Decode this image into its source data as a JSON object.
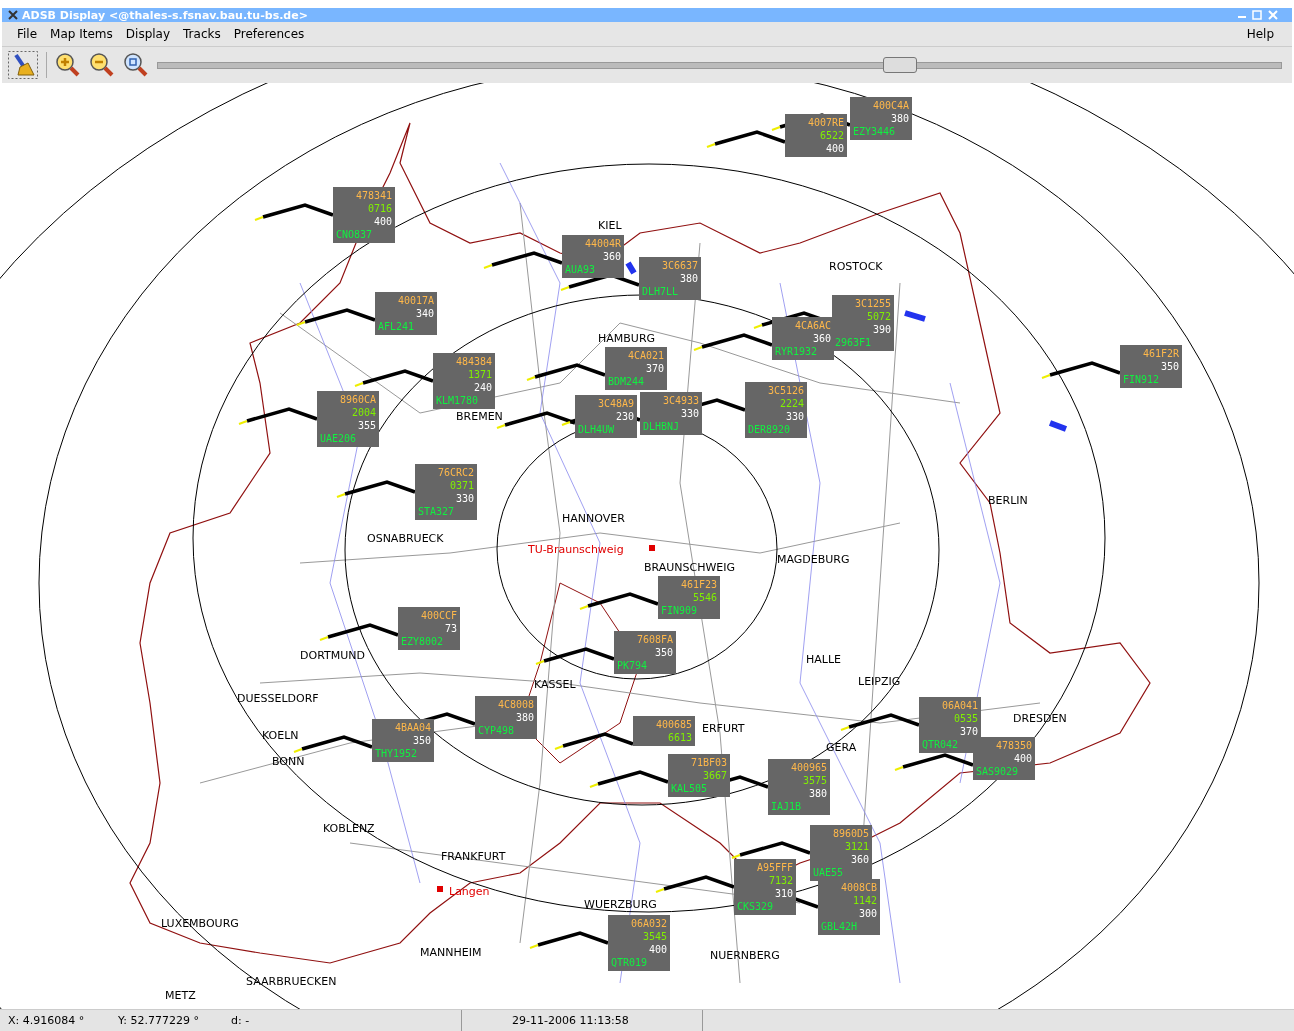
{
  "window": {
    "title": "ADSB Display <@thales-s.fsnav.bau.tu-bs.de>"
  },
  "menu": [
    {
      "label": "File"
    },
    {
      "label": "Map Items"
    },
    {
      "label": "Display"
    },
    {
      "label": "Tracks"
    },
    {
      "label": "Preferences"
    },
    {
      "label": "Help"
    }
  ],
  "zoom_slider": {
    "level": 0.66
  },
  "map": {
    "cities": [
      "KIEL",
      "ROSTOCK",
      "HAMBURG",
      "BREMEN",
      "HANNOVER",
      "OSNABRUECK",
      "BRAUNSCHWEIG",
      "MAGDEBURG",
      "BERLIN",
      "DORTMUND",
      "DUESSELDORF",
      "KOELN",
      "BONN",
      "KASSEL",
      "HALLE",
      "LEIPZIG",
      "ERFURT",
      "GERA",
      "DRESDEN",
      "KOBLENZ",
      "FRANKFURT",
      "WUERZBURG",
      "MANNHEIM",
      "NUERNBERG",
      "LUXEMBOURG",
      "SAARBRUECKEN",
      "METZ"
    ],
    "sites": [
      "TU-Braunschweig",
      "Langen"
    ],
    "aircraft": [
      {
        "icao": "4007RE",
        "squawk": "6522",
        "altitude": "400"
      },
      {
        "icao": "400C4A",
        "altitude": "380",
        "callsign": "EZY3446"
      },
      {
        "icao": "478341",
        "squawk": "0716",
        "altitude": "400",
        "callsign": "CNO837"
      },
      {
        "icao": "44004R",
        "altitude": "360",
        "callsign": "AUA93"
      },
      {
        "icao": "3C6637",
        "altitude": "380",
        "callsign": "DLH7LL"
      },
      {
        "icao": "40017A",
        "altitude": "340",
        "callsign": "AFL241"
      },
      {
        "icao": "4CA6AC",
        "altitude": "360",
        "callsign": "RYR1932"
      },
      {
        "icao": "3C1255",
        "squawk": "5072",
        "altitude": "390",
        "callsign": "2963F1"
      },
      {
        "icao": "4CA021",
        "altitude": "370",
        "callsign": "BDM244"
      },
      {
        "icao": "8960CA",
        "squawk": "2004",
        "altitude": "355",
        "callsign": "UAE206"
      },
      {
        "icao": "484384",
        "squawk": "1371",
        "altitude": "240",
        "callsign": "KLM1780"
      },
      {
        "icao": "3C48A9",
        "altitude": "230",
        "callsign": "DLH4UW"
      },
      {
        "icao": "3C4933",
        "altitude": "330",
        "callsign": "DLHBNJ"
      },
      {
        "icao": "3C5126",
        "squawk": "2224",
        "altitude": "330",
        "callsign": "DER8920"
      },
      {
        "icao": "461F2R",
        "altitude": "350",
        "callsign": "FIN912"
      },
      {
        "icao": "76CRC2",
        "squawk": "0371",
        "altitude": "330",
        "callsign": "STA327"
      },
      {
        "icao": "461F23",
        "squawk": "5546",
        "callsign": "FIN909"
      },
      {
        "icao": "400CCF",
        "altitude": "73",
        "callsign": "EZY8002"
      },
      {
        "icao": "7608FA",
        "altitude": "350",
        "callsign": "PK794"
      },
      {
        "icao": "4BAA04",
        "altitude": "350",
        "callsign": "THY1952"
      },
      {
        "icao": "4C8008",
        "altitude": "380",
        "callsign": "CYP498"
      },
      {
        "icao": "400685",
        "squawk": "6613"
      },
      {
        "icao": "06A041",
        "squawk": "0535",
        "altitude": "370",
        "callsign": "QTR042"
      },
      {
        "icao": "71BF03",
        "squawk": "3667",
        "callsign": "KAL505"
      },
      {
        "icao": "400965",
        "squawk": "3575",
        "altitude": "380",
        "callsign": "IAJ1B"
      },
      {
        "icao": "478350",
        "altitude": "400",
        "callsign": "SAS9029"
      },
      {
        "icao": "06A032",
        "squawk": "3545",
        "altitude": "400",
        "callsign": "QTR019"
      },
      {
        "icao": "A95FFF",
        "squawk": "7132",
        "altitude": "310",
        "callsign": "CKS329"
      },
      {
        "icao": "8960D5",
        "squawk": "3121",
        "altitude": "360",
        "callsign": "UAE55"
      },
      {
        "icao": "4008CB",
        "squawk": "1142",
        "altitude": "300",
        "callsign": "GBL42H"
      }
    ]
  },
  "status_bar": {
    "x": "X: 4.916084 °",
    "y": "Y: 52.777229 °",
    "d": "d: -",
    "datetime": "29-11-2006   11:13:58"
  }
}
